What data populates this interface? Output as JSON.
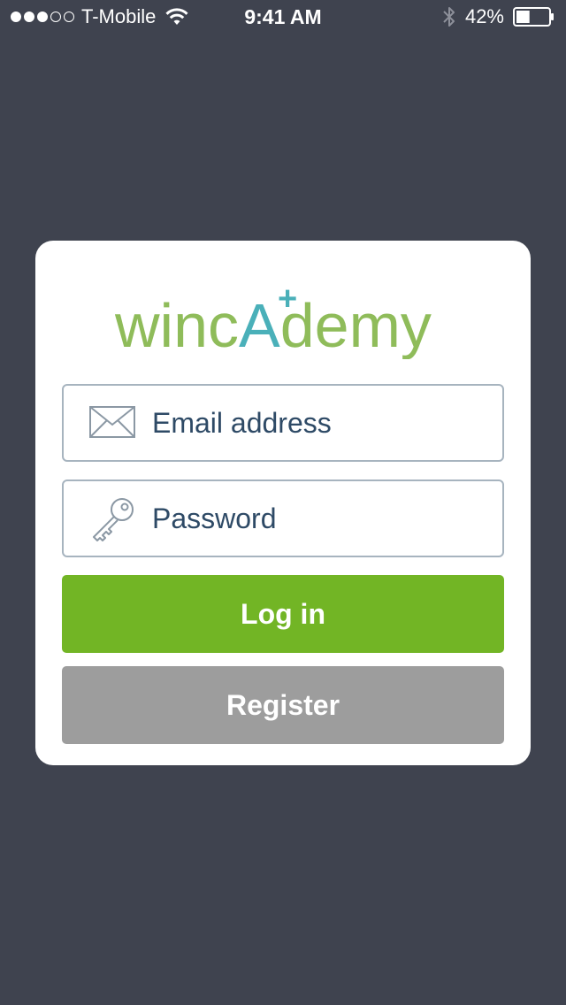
{
  "status_bar": {
    "carrier": "T-Mobile",
    "time": "9:41 AM",
    "battery": "42%",
    "battery_level": 0.42,
    "signal_bars": 3,
    "signal_total": 5
  },
  "logo": {
    "part_green_1": "winc",
    "part_teal": "A",
    "part_plus": "+",
    "part_green_2": "demy",
    "brand_green": "#8fbc5a",
    "brand_teal": "#4ab0b9"
  },
  "form": {
    "email_placeholder": "Email address",
    "password_placeholder": "Password",
    "login_label": "Log in",
    "register_label": "Register"
  },
  "colors": {
    "background": "#3f434f",
    "login_button": "#72b525",
    "register_button": "#9d9d9d",
    "field_border": "#a7b4bf",
    "field_text": "#2e4a66"
  },
  "icons": {
    "email": "envelope-icon",
    "password": "key-icon",
    "wifi": "wifi-icon",
    "bluetooth": "bluetooth-icon",
    "battery": "battery-icon"
  }
}
